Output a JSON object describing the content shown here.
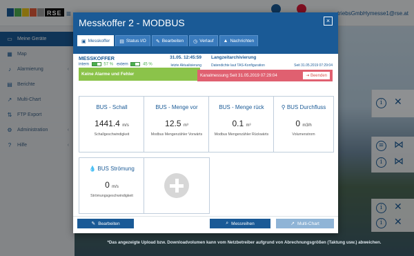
{
  "app": {
    "logo_text": "RSE",
    "logo_colors": [
      "#1a5a96",
      "#4caf50",
      "#e8c21a",
      "#e05a3a",
      "#9e9e9e"
    ],
    "user_text": "triebsGmbHymesse1@rse.at"
  },
  "sidebar": {
    "items": [
      {
        "label": "Meine Geräte",
        "icon": "devices-icon",
        "glyph": "▭"
      },
      {
        "label": "Map",
        "icon": "map-icon",
        "glyph": "▦"
      },
      {
        "label": "Alarmierung",
        "icon": "bell-icon",
        "glyph": "♪"
      },
      {
        "label": "Berichte",
        "icon": "report-icon",
        "glyph": "▤"
      },
      {
        "label": "Multi-Chart",
        "icon": "chart-icon",
        "glyph": "↗"
      },
      {
        "label": "FTP Export",
        "icon": "ftp-icon",
        "glyph": "⇅"
      },
      {
        "label": "Administration",
        "icon": "admin-icon",
        "glyph": "⚙"
      },
      {
        "label": "Hilfe",
        "icon": "help-icon",
        "glyph": "❓"
      }
    ]
  },
  "footnote": "*Das angezeigte Upload bzw. Downloadvolumen kann vom Netzbetreiber aufgrund von Abrechnungsgrößen (Taktung usw.) abweichen.",
  "modal": {
    "title": "Messkoffer 2 - MODBUS",
    "close_label": "×",
    "tabs": [
      {
        "label": "Messkoffer",
        "icon": "case-icon",
        "glyph": "▣"
      },
      {
        "label": "Status I/O",
        "icon": "status-icon",
        "glyph": "▤"
      },
      {
        "label": "Bearbeiten",
        "icon": "edit-icon",
        "glyph": "✎"
      },
      {
        "label": "Verlauf",
        "icon": "history-icon",
        "glyph": "◷"
      },
      {
        "label": "Nachrichten",
        "icon": "warning-icon",
        "glyph": "▲"
      }
    ],
    "device": {
      "name": "MESSKOFFER",
      "intern_label": "intern",
      "intern_pct": "57 %",
      "intern_level": 0.57,
      "extern_label": "extern",
      "extern_pct": "45 %",
      "extern_level": 0.45,
      "timestamp": "31.05. 12:45:59",
      "timestamp_sub": "letzte Aktualisierung"
    },
    "archive": {
      "title": "Langzeitarchivierung",
      "subtitle": "Datendichte laut TAS-Konfiguration",
      "since": "Seit 31.05.2019 07:29:04"
    },
    "alarm_bar": "Keine Alarme und Fehler",
    "channel_bar": "Kanalmessung Seit 31.05.2019 07:29:04",
    "channel_button": "Beenden",
    "tiles": [
      {
        "title": "BUS - Schall",
        "value": "1441.4",
        "unit": "m/s",
        "sub": "Schallgeschwindigkeit",
        "icon": ""
      },
      {
        "title": "BUS - Menge vor",
        "value": "12.5",
        "unit": "m³",
        "sub": "Modbus Mengenzähler Vorwärts",
        "icon": ""
      },
      {
        "title": "BUS - Menge rück",
        "value": "0.1",
        "unit": "m³",
        "sub": "Modbus Mengenzähler Rückwärts",
        "icon": ""
      },
      {
        "title": "BUS Durchfluss",
        "value": "0",
        "unit": "m3/h",
        "sub": "Volumenstrom",
        "icon": "faucet-icon"
      },
      {
        "title": "BUS Strömung",
        "value": "0",
        "unit": "m/s",
        "sub": "Strömungsgeschwindigkeit",
        "icon": "drop-icon"
      }
    ],
    "footer": {
      "edit": "Bearbeiten",
      "series": "Messreihen",
      "multichart": "Multi-Chart"
    }
  }
}
